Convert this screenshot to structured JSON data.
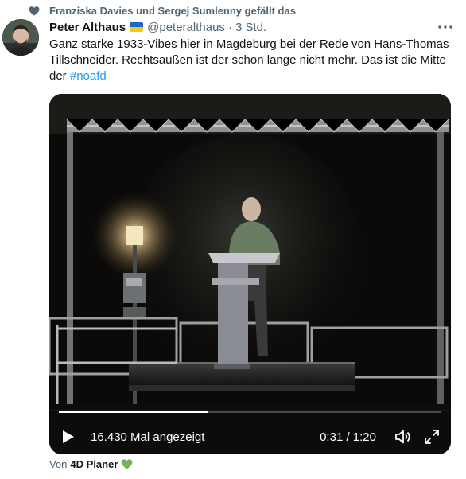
{
  "social_context": {
    "text": "Franziska Davies und Sergej Sumlenny gefällt das",
    "icon": "heart-icon"
  },
  "author": {
    "name": "Peter Althaus",
    "badge": "ukraine-flag-icon",
    "handle": "@peteralthaus",
    "separator": "·",
    "time": "3 Std."
  },
  "tweet": {
    "text": "Ganz starke 1933-Vibes hier in Magdeburg bei der Rede von Hans-Thomas Tillschneider. Rechtsaußen ist der schon lange nicht mehr. Das ist die Mitte der ",
    "hashtag": "#noafd"
  },
  "video": {
    "views": "16.430 Mal angezeigt",
    "time": "0:31 / 1:20",
    "progress": 0.39
  },
  "source": {
    "prefix": "Von",
    "brand": "4D Planer",
    "icon": "green-heart-icon"
  },
  "colors": {
    "link": "#1d9bf0",
    "muted": "#536471",
    "text": "#0f1419",
    "green_heart": "#78b159"
  }
}
